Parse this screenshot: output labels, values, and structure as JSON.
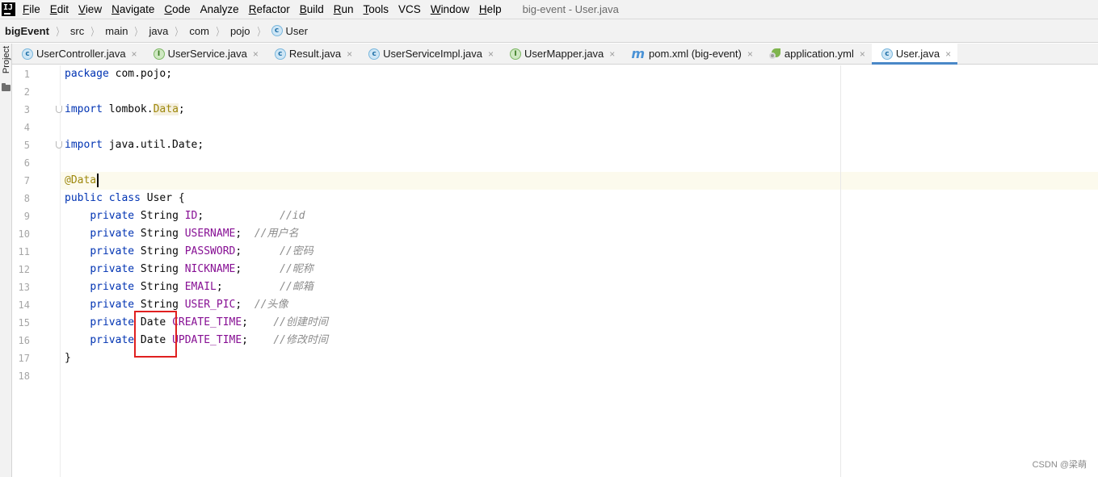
{
  "menu": {
    "items": [
      {
        "mnemonic": "F",
        "rest": "ile"
      },
      {
        "mnemonic": "E",
        "rest": "dit"
      },
      {
        "mnemonic": "V",
        "rest": "iew"
      },
      {
        "mnemonic": "N",
        "rest": "avigate"
      },
      {
        "mnemonic": "C",
        "rest": "ode"
      },
      {
        "mnemonic": "",
        "rest": "Analyze"
      },
      {
        "mnemonic": "R",
        "rest": "efactor"
      },
      {
        "mnemonic": "B",
        "rest": "uild"
      },
      {
        "mnemonic": "R",
        "rest": "un"
      },
      {
        "mnemonic": "T",
        "rest": "ools"
      },
      {
        "mnemonic": "",
        "rest": "VCS"
      },
      {
        "mnemonic": "W",
        "rest": "indow"
      },
      {
        "mnemonic": "H",
        "rest": "elp"
      }
    ],
    "window_title": "big-event - User.java",
    "logo_text": "IJ"
  },
  "breadcrumb": {
    "project": "bigEvent",
    "parts": [
      "src",
      "main",
      "java",
      "com",
      "pojo"
    ],
    "current": "User",
    "current_icon": "java-class-icon"
  },
  "sidebar": {
    "project_label": "Project",
    "folder_icon": "folder-icon"
  },
  "tabs": [
    {
      "label": "UserController.java",
      "icon": "java-class-icon",
      "active": false
    },
    {
      "label": "UserService.java",
      "icon": "java-interface-icon",
      "active": false
    },
    {
      "label": "Result.java",
      "icon": "java-class-icon",
      "active": false
    },
    {
      "label": "UserServiceImpl.java",
      "icon": "java-class-icon",
      "active": false
    },
    {
      "label": "UserMapper.java",
      "icon": "java-interface-icon",
      "active": false
    },
    {
      "label": "pom.xml (big-event)",
      "icon": "maven-icon",
      "active": false
    },
    {
      "label": "application.yml",
      "icon": "spring-yml-icon",
      "active": false
    },
    {
      "label": "User.java",
      "icon": "java-class-icon",
      "active": true
    }
  ],
  "tab_close_glyph": "×",
  "editor": {
    "line_numbers": [
      "1",
      "2",
      "3",
      "4",
      "5",
      "6",
      "7",
      "8",
      "9",
      "10",
      "11",
      "12",
      "13",
      "14",
      "15",
      "16",
      "17",
      "18"
    ],
    "caret_line": 7,
    "code": {
      "l1_kw": "package",
      "l1_rest": " com.pojo;",
      "l3_kw": "import",
      "l3_pre": " lombok.",
      "l3_ref": "Data",
      "l3_post": ";",
      "l5_kw": "import",
      "l5_rest": " java.util.Date;",
      "l7_anno": "@Data",
      "l8_kw": "public class",
      "l8_rest": " User {",
      "fields": [
        {
          "mod": "private",
          "type": " String ",
          "name": "ID",
          "pad": ";            ",
          "comment": "//id"
        },
        {
          "mod": "private",
          "type": " String ",
          "name": "USERNAME",
          "pad": ";  ",
          "comment": "//用户名"
        },
        {
          "mod": "private",
          "type": " String ",
          "name": "PASSWORD",
          "pad": ";      ",
          "comment": "//密码"
        },
        {
          "mod": "private",
          "type": " String ",
          "name": "NICKNAME",
          "pad": ";      ",
          "comment": "//昵称"
        },
        {
          "mod": "private",
          "type": " String ",
          "name": "EMAIL",
          "pad": ";         ",
          "comment": "//邮箱"
        },
        {
          "mod": "private",
          "type": " String ",
          "name": "USER_PIC",
          "pad": ";  ",
          "comment": "//头像"
        },
        {
          "mod": "private",
          "type": " Date ",
          "name": "CREATE_TIME",
          "pad": ";    ",
          "comment": "//创建时间"
        },
        {
          "mod": "private",
          "type": " Date ",
          "name": "UPDATE_TIME",
          "pad": ";    ",
          "comment": "//修改时间"
        }
      ],
      "l17": "}"
    },
    "annotation_color": "#e02020"
  },
  "watermark": "CSDN @梁萌",
  "colors": {
    "keyword": "#0033b3",
    "field": "#871094",
    "comment": "#8c8c8c",
    "annotation": "#9e880d",
    "active_tab_underline": "#4a88c7"
  }
}
